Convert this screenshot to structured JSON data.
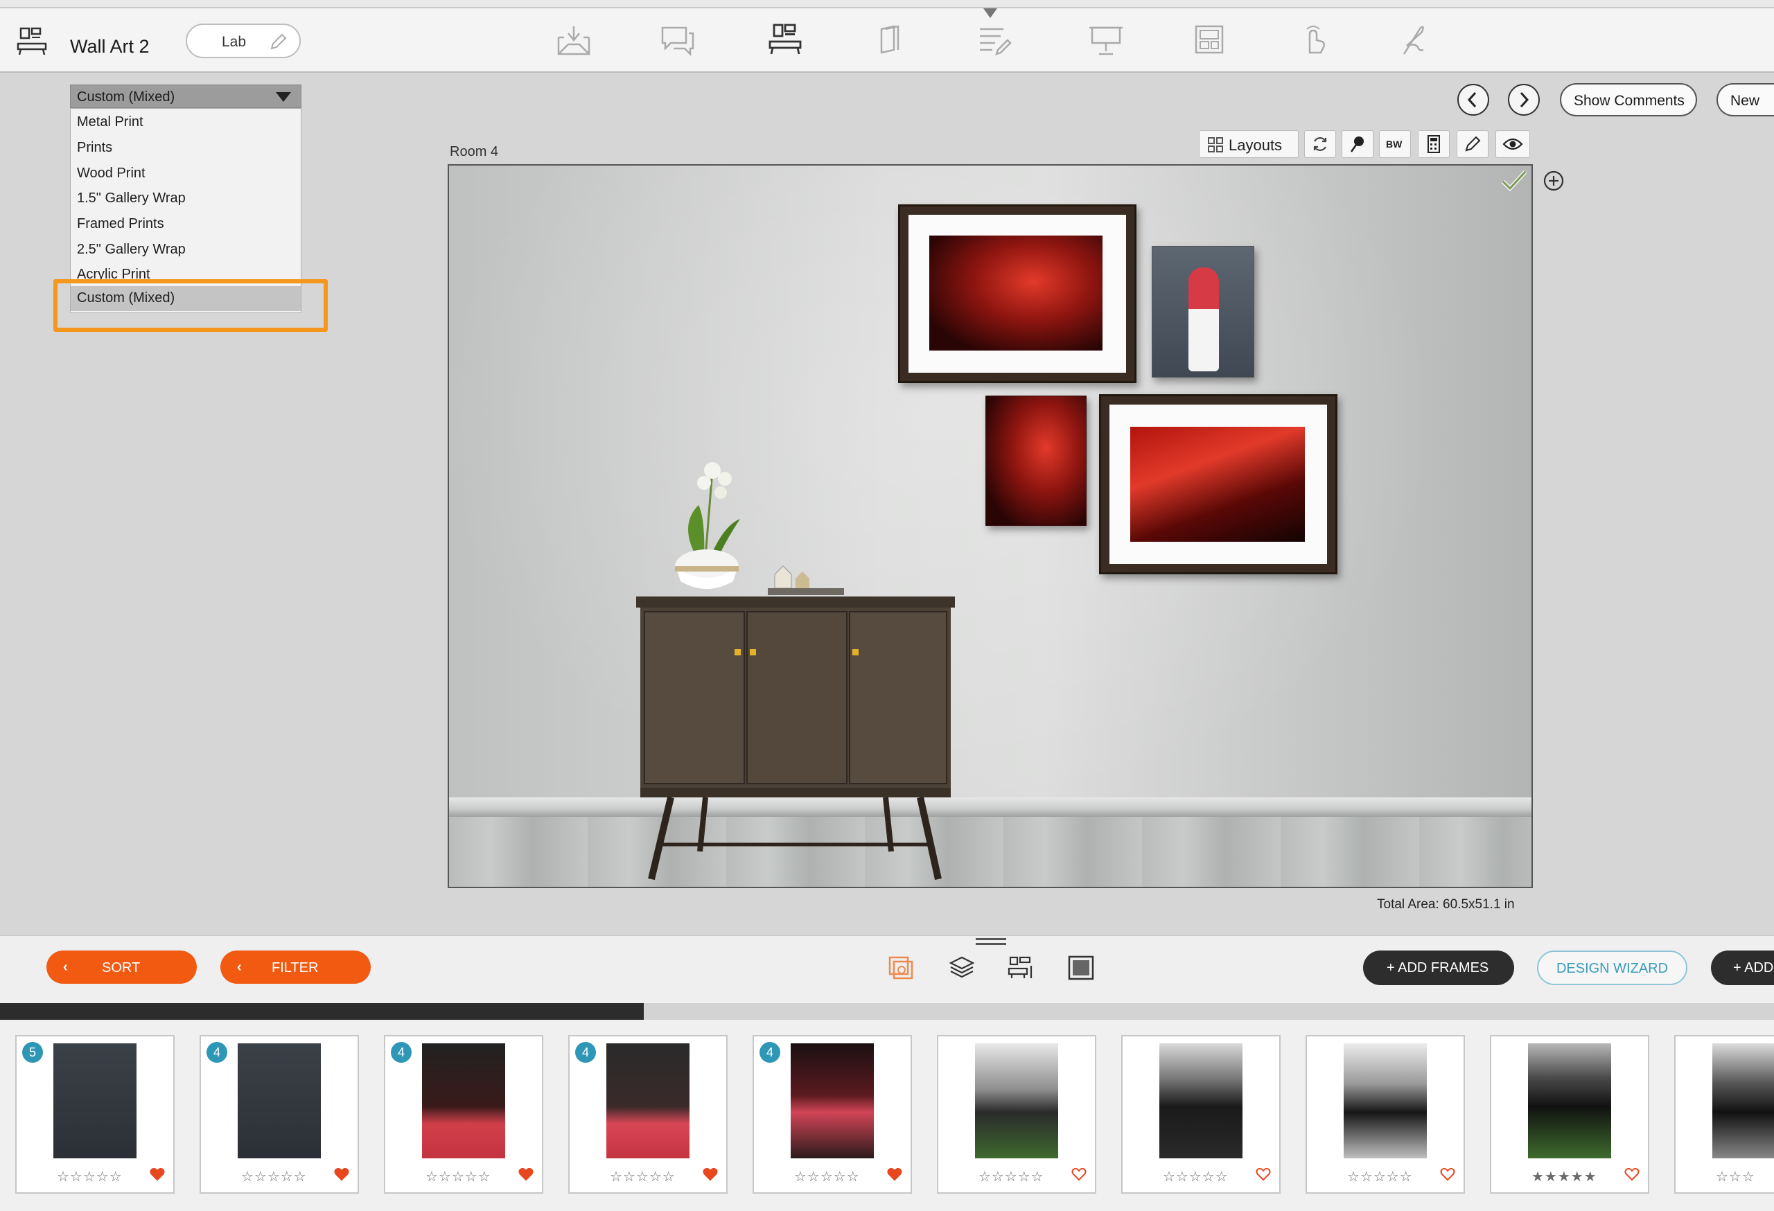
{
  "header": {
    "title": "Wall Art 2",
    "lab_button": "Lab"
  },
  "nav_icons": [
    "import-icon",
    "comments-icon",
    "wall-art-icon",
    "album-icon",
    "order-form-icon",
    "presentation-icon",
    "layout-icon",
    "hand-tap-icon",
    "signature-icon"
  ],
  "dropdown": {
    "selected": "Custom (Mixed)",
    "options": [
      "Metal Print",
      "Prints",
      "Wood Print",
      "1.5\" Gallery Wrap",
      "Framed Prints",
      "2.5\" Gallery Wrap",
      "Acrylic Print",
      "Custom (Mixed)"
    ]
  },
  "controls": {
    "show_comments": "Show Comments",
    "new_label": "New",
    "layouts_label": "Layouts",
    "bw_label": "BW"
  },
  "room": {
    "label": "Room 4",
    "total_area": "Total Area: 60.5x51.1 in"
  },
  "bottom": {
    "sort_label": "SORT",
    "filter_label": "FILTER",
    "add_frames_label": "+ ADD FRAMES",
    "design_wizard_label": "DESIGN WIZARD",
    "add_label": "+ ADD",
    "scroll_progress": 0.363
  },
  "thumbnails": [
    {
      "badge": "5",
      "stars": "☆☆☆☆☆",
      "favorite": true
    },
    {
      "badge": "4",
      "stars": "☆☆☆☆☆",
      "favorite": true
    },
    {
      "badge": "4",
      "stars": "☆☆☆☆☆",
      "favorite": true
    },
    {
      "badge": "4",
      "stars": "☆☆☆☆☆",
      "favorite": true
    },
    {
      "badge": "4",
      "stars": "☆☆☆☆☆",
      "favorite": true
    },
    {
      "badge": "",
      "stars": "☆☆☆☆☆",
      "favorite": false
    },
    {
      "badge": "",
      "stars": "☆☆☆☆☆",
      "favorite": false
    },
    {
      "badge": "",
      "stars": "☆☆☆☆☆",
      "favorite": false
    },
    {
      "badge": "",
      "stars": "★★★★★",
      "favorite": false
    },
    {
      "badge": "",
      "stars": "☆☆☆",
      "favorite": false
    }
  ],
  "colors": {
    "accent_orange": "#f25a12",
    "highlight_orange": "#f5961d",
    "badge_blue": "#2e97b5",
    "heart_red": "#e8461c"
  }
}
